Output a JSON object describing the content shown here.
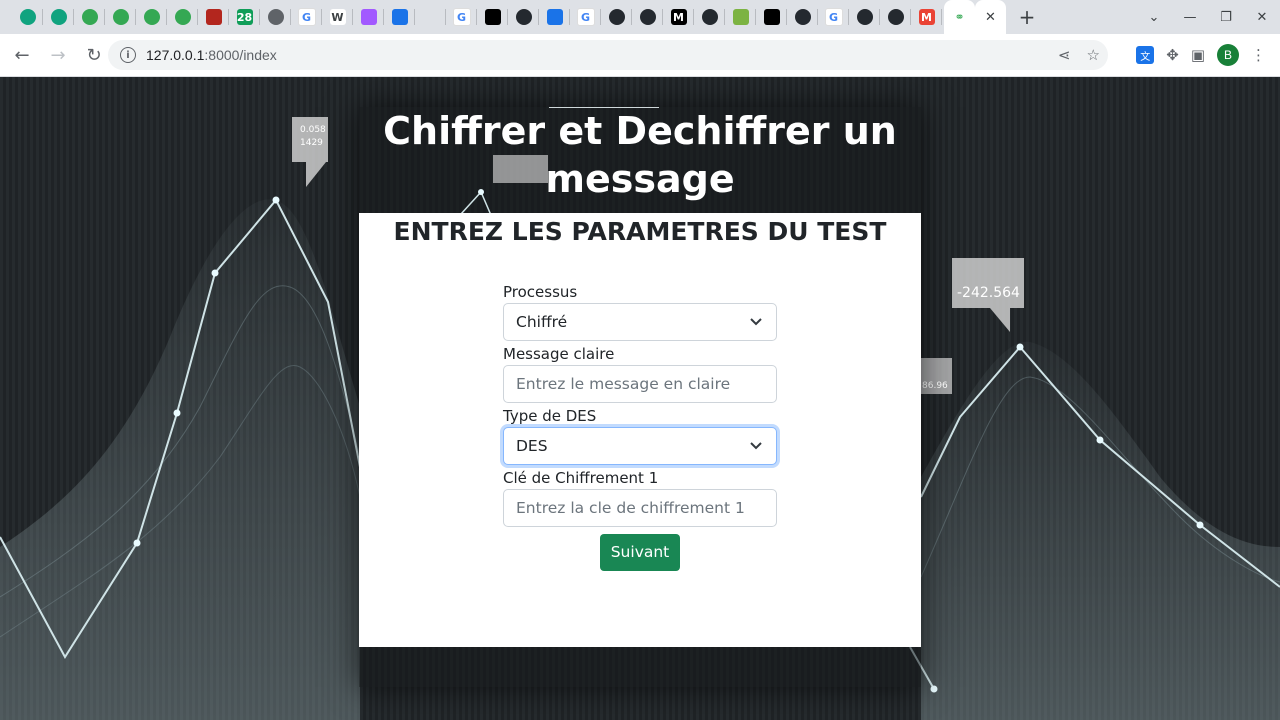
{
  "browser": {
    "tabs": [
      {
        "icon": "openai-icon",
        "color": "#10a37f"
      },
      {
        "icon": "openai-icon",
        "color": "#10a37f"
      },
      {
        "icon": "leaf-icon",
        "color": "#34a853"
      },
      {
        "icon": "leaf-icon",
        "color": "#34a853"
      },
      {
        "icon": "leaf-icon",
        "color": "#34a853"
      },
      {
        "icon": "leaf-icon",
        "color": "#34a853"
      },
      {
        "icon": "diamond-icon",
        "color": "#b3261e"
      },
      {
        "icon": "badge-28-icon",
        "color": "#0f9d58",
        "text": "28"
      },
      {
        "icon": "globe-icon",
        "color": "#5f6368"
      },
      {
        "icon": "google-icon",
        "color": "#4285f4",
        "text": "G"
      },
      {
        "icon": "wikipedia-icon",
        "color": "#3c4043",
        "text": "W"
      },
      {
        "icon": "figma-icon",
        "color": "#a259ff"
      },
      {
        "icon": "shield-icon",
        "color": "#1a73e8"
      },
      {
        "icon": "blank-icon",
        "color": "#dee1e6"
      },
      {
        "icon": "google-icon",
        "color": "#4285f4",
        "text": "G"
      },
      {
        "icon": "medium-icon",
        "color": "#000000"
      },
      {
        "icon": "github-icon",
        "color": "#24292f"
      },
      {
        "icon": "bluetooth-icon",
        "color": "#1a73e8"
      },
      {
        "icon": "google-icon",
        "color": "#4285f4",
        "text": "G"
      },
      {
        "icon": "github-icon",
        "color": "#24292f"
      },
      {
        "icon": "github-icon",
        "color": "#24292f"
      },
      {
        "icon": "m-icon",
        "color": "#000000",
        "text": "M"
      },
      {
        "icon": "github-icon",
        "color": "#24292f"
      },
      {
        "icon": "download-icon",
        "color": "#7cb342"
      },
      {
        "icon": "medium-icon",
        "color": "#000000"
      },
      {
        "icon": "github-icon",
        "color": "#24292f"
      },
      {
        "icon": "google-icon",
        "color": "#4285f4",
        "text": "G"
      },
      {
        "icon": "github-icon",
        "color": "#24292f"
      },
      {
        "icon": "github-icon",
        "color": "#24292f"
      },
      {
        "icon": "gmail-icon",
        "color": "#ea4335",
        "text": "M"
      }
    ],
    "active_tab": {
      "icon": "link-icon",
      "color": "#34a853"
    },
    "url_host": "127.0.0.1",
    "url_path": ":8000/index",
    "profile_initial": "B"
  },
  "page": {
    "title": "Chiffrer et Dechiffrer un message",
    "card_heading": "ENTREZ LES PARAMETRES DU TEST",
    "fields": {
      "processus_label": "Processus",
      "processus_value": "Chiffré",
      "message_label": "Message claire",
      "message_placeholder": "Entrez le message en claire",
      "type_label": "Type de DES",
      "type_value": "DES",
      "key_label": "Clé de Chiffrement 1",
      "key_placeholder": "Entrez la cle de chiffrement 1"
    },
    "submit_label": "Suivant",
    "background_labels": [
      "0.058",
      "1429",
      "-242.564",
      "-242.564",
      "86.96"
    ]
  }
}
